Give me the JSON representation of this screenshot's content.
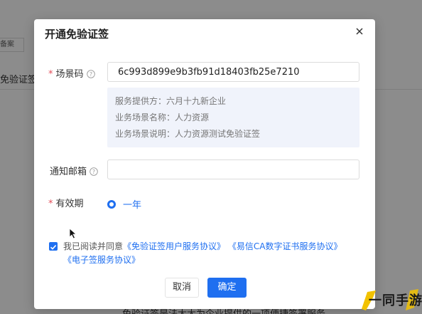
{
  "background": {
    "tag_text": "备案",
    "side_label": "免验证签",
    "bottom_text": "免验证签是法大大为企业提供的一项便捷签署服务"
  },
  "dialog": {
    "title": "开通免验证签",
    "close_icon": "close-icon",
    "scene_code": {
      "label": "场景码",
      "required_mark": "*",
      "help_icon": "help-circle-icon",
      "value": "6c993d899e9b3fb91d18403fb25e7210"
    },
    "info": {
      "provider": "服务提供方：六月十九新企业",
      "scene_name": "业务场景名称：人力资源",
      "scene_desc": "业务场景说明：人力资源测试免验证签"
    },
    "email": {
      "label": "通知邮箱",
      "help_icon": "help-circle-icon",
      "value": "",
      "placeholder": ""
    },
    "validity": {
      "label": "有效期",
      "required_mark": "*",
      "option": "一年",
      "selected": true
    },
    "agreement": {
      "checked": true,
      "prefix": "我已阅读并同意",
      "link1": "《免验证签用户服务协议》",
      "link2": "《易信CA数字证书服务协议》",
      "link3": "《电子签服务协议》"
    },
    "buttons": {
      "cancel": "取消",
      "ok": "确定"
    }
  },
  "watermark": {
    "text": "一同手游网"
  },
  "colors": {
    "accent": "#1f6ff0",
    "required": "#e34d59",
    "info_bg": "#f0f3fb"
  }
}
